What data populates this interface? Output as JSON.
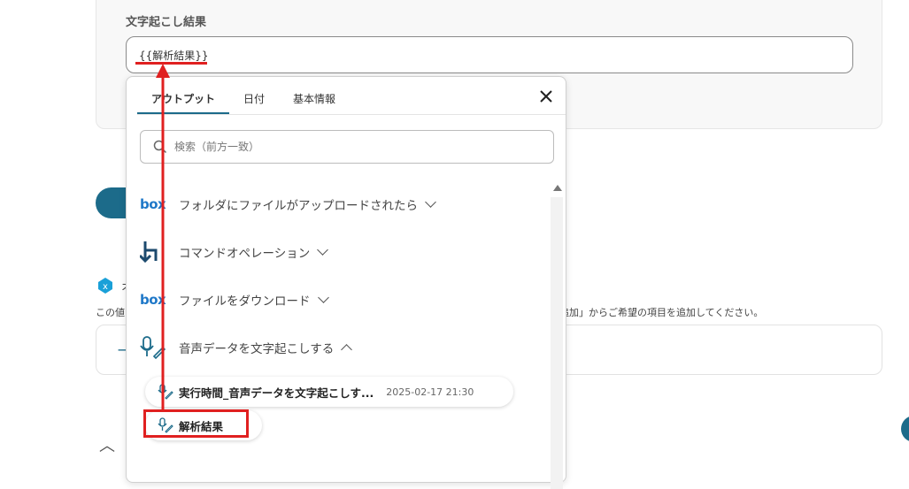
{
  "field": {
    "label": "文字起こし結果",
    "value": "{{解析結果}}"
  },
  "background": {
    "hint_left": "この値",
    "hint_right": "追加」からご希望の項目を追加してください。",
    "title_fragment": "オ"
  },
  "popup": {
    "tabs": [
      "アウトプット",
      "日付",
      "基本情報"
    ],
    "active_tab": 0,
    "search_placeholder": "検索（前方一致）",
    "groups": [
      {
        "icon": "box-logo-icon",
        "logo_text": "box",
        "label": "フォルダにファイルがアップロードされたら",
        "expanded": false
      },
      {
        "icon": "command-icon",
        "logo_text": "",
        "label": "コマンドオペレーション",
        "expanded": false
      },
      {
        "icon": "box-logo-icon",
        "logo_text": "box",
        "label": "ファイルをダウンロード",
        "expanded": false
      },
      {
        "icon": "mic-icon",
        "logo_text": "",
        "label": "音声データを文字起こしする",
        "expanded": true
      }
    ],
    "chips": [
      {
        "label": "実行時間_音声データを文字起こしす...",
        "time": "2025-02-17 21:30"
      },
      {
        "label": "解析結果",
        "time": ""
      }
    ]
  },
  "colors": {
    "accent": "#1c6b8a",
    "annotation": "#e02020",
    "box_brand": "#1f78c8"
  }
}
